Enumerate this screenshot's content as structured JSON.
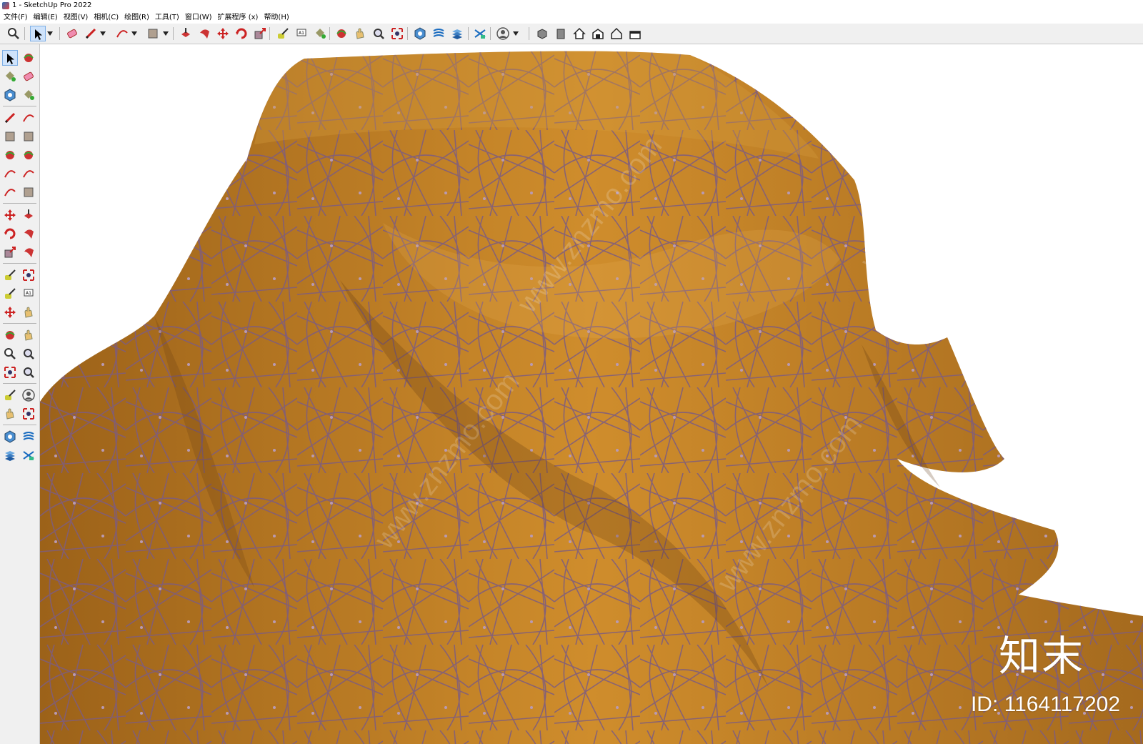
{
  "window": {
    "title": "1 - SketchUp Pro 2022"
  },
  "menu": [
    "文件(F)",
    "编辑(E)",
    "视图(V)",
    "相机(C)",
    "绘图(R)",
    "工具(T)",
    "窗口(W)",
    "扩展程序 (x)",
    "帮助(H)"
  ],
  "toolbar": {
    "items": [
      {
        "name": "zoom-icon",
        "active": false
      },
      {
        "name": "select-icon",
        "active": true
      },
      {
        "name": "eraser-icon",
        "active": false
      },
      {
        "name": "pencil-icon",
        "active": false
      },
      {
        "name": "arc-icon",
        "active": false
      },
      {
        "name": "rectangle-icon",
        "active": false
      },
      {
        "name": "push-pull-icon",
        "active": false
      },
      {
        "name": "follow-me-icon",
        "active": false
      },
      {
        "name": "move-icon",
        "active": false
      },
      {
        "name": "rotate-icon",
        "active": false
      },
      {
        "name": "scale-icon",
        "active": false
      },
      {
        "name": "tape-measure-icon",
        "active": false
      },
      {
        "name": "text-icon",
        "active": false
      },
      {
        "name": "paint-bucket-icon",
        "active": false
      },
      {
        "name": "orbit-icon",
        "active": false
      },
      {
        "name": "pan-icon",
        "active": false
      },
      {
        "name": "zoom-window-icon",
        "active": false
      },
      {
        "name": "zoom-extents-icon",
        "active": false
      },
      {
        "name": "components-icon",
        "active": false
      },
      {
        "name": "sandbox-icon",
        "active": false
      },
      {
        "name": "layers-icon",
        "active": false
      },
      {
        "name": "styles-icon",
        "active": false
      },
      {
        "name": "user-account-icon",
        "active": false
      },
      {
        "name": "iso-view-icon",
        "active": false
      },
      {
        "name": "front-view-icon",
        "active": false
      },
      {
        "name": "house-view-icon",
        "active": false
      },
      {
        "name": "warehouse-icon",
        "active": false
      },
      {
        "name": "house-outline-icon",
        "active": false
      },
      {
        "name": "extension-warehouse-icon",
        "active": false
      }
    ]
  },
  "sidebar": {
    "items": [
      "select-icon",
      "orbit-icon",
      "paint-bucket-icon",
      "eraser-icon",
      "component-icon",
      "tag-icon",
      "pencil-icon",
      "freehand-icon",
      "rectangle-icon",
      "rotated-rectangle-icon",
      "circle-icon",
      "polygon-icon",
      "arc-icon",
      "two-point-arc-icon",
      "three-point-arc-icon",
      "pie-icon",
      "move-icon",
      "push-pull-icon",
      "rotate-icon",
      "follow-me-icon",
      "scale-icon",
      "offset-icon",
      "tape-measure-icon",
      "dimension-icon",
      "protractor-icon",
      "text-icon",
      "axes-icon",
      "3d-text-icon",
      "orbit-view-icon",
      "pan-icon",
      "zoom-icon",
      "zoom-window-icon",
      "zoom-extents-icon",
      "previous-view-icon",
      "position-camera-icon",
      "look-around-icon",
      "walk-icon",
      "section-plane-icon",
      "components-panel-icon",
      "sandbox-icon",
      "layers-icon",
      "styles-icon"
    ]
  },
  "viewport": {
    "model": "draped-cloth",
    "fabric_color": "#c9862a",
    "pattern_color": "#7a5a7a"
  },
  "watermark": {
    "logo": "知末",
    "id": "ID: 1164117202",
    "diagonal": "www.znzmo.com"
  }
}
